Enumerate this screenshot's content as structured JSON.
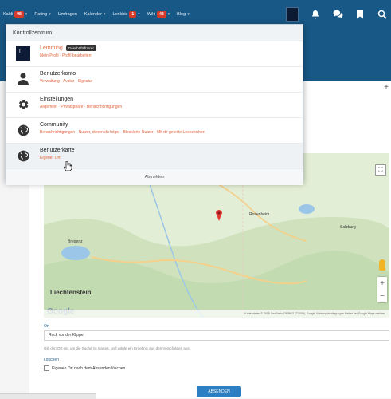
{
  "topbar": {
    "nav": [
      {
        "label": "Kaldi",
        "badge": "98"
      },
      {
        "label": "Rating",
        "badge": ""
      },
      {
        "label": "Umfragen",
        "badge": ""
      },
      {
        "label": "Kalender",
        "badge": ""
      },
      {
        "label": "Lenkbis",
        "badge": "1"
      },
      {
        "label": "Wiki",
        "badge": "48"
      },
      {
        "label": "Blog",
        "badge": ""
      }
    ],
    "icons": [
      "avatar",
      "bell-icon",
      "chat-icon",
      "bookmark-icon",
      "search-icon"
    ]
  },
  "dropdown": {
    "header": "Kontrollzentrum",
    "items": [
      {
        "title": "Lemming",
        "tag": "Geschäftsführer",
        "sub": "Mein Profil · Profil bearbeiten",
        "icon": "user-avatar"
      },
      {
        "title": "Benutzerkonto",
        "sub": "Verwaltung · Avatar · Signatur",
        "icon": "person-icon"
      },
      {
        "title": "Einstellungen",
        "sub": "Allgemein · Privatsphäre · Benachrichtigungen",
        "icon": "gear-icon"
      },
      {
        "title": "Community",
        "sub": "Benachrichtigungen · Nutzer, denen du folgst · Blockierte Nutzer · Mit dir geteilte Lesezeichen",
        "icon": "globe-icon"
      },
      {
        "title": "Benutzerkarte",
        "sub": "Eigener Ort",
        "icon": "globe-icon"
      }
    ],
    "footer": "Abmelden"
  },
  "map": {
    "labels": {
      "liechtenstein": "Liechtenstein",
      "google": "Google",
      "rosenheim": "Rosenheim",
      "salzburg": "Salzburg",
      "bregenz": "Bregenz"
    },
    "footer": "Kartendaten © 2018 GeoBasis-DE/BKG (©2009), Google  Nutzungsbedingungen  Fehler bei Google Maps melden"
  },
  "form": {
    "ort_label": "Ort",
    "ort_value": "Ruck vor der Klippe",
    "hint": "Gib den Ort ein, um die Suche zu starten, und wähle ein Ergebnis aus den Vorschlägen aus.",
    "loeschen_label": "Löschen",
    "checkbox_label": "Eigenen Ort nach dem Absenden löschen.",
    "submit_label": "ABSENDEN"
  },
  "colors": {
    "topbar": "#185886",
    "accent": "#e3663b",
    "button": "#2d7fc3"
  }
}
